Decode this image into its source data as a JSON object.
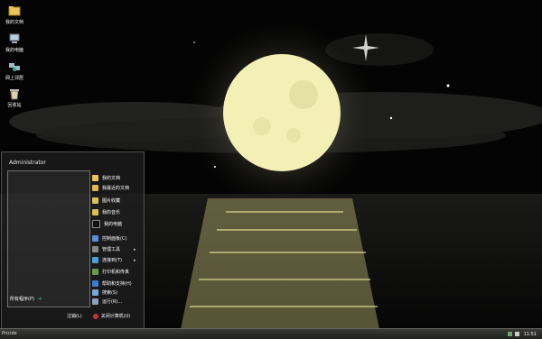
{
  "desktop": {
    "icons": [
      {
        "label": "我的文档",
        "icon": "folder-icon"
      },
      {
        "label": "我的电脑",
        "icon": "computer-icon"
      },
      {
        "label": "网上邻居",
        "icon": "network-icon"
      },
      {
        "label": "回收站",
        "icon": "recycle-bin-icon"
      }
    ]
  },
  "start_menu": {
    "user": "Administrator",
    "all_programs": "所有程序(P)",
    "right_items": [
      {
        "label": "我的文档",
        "icon": "folder-icon"
      },
      {
        "label": "我最近的文档",
        "icon": "recent-docs-icon"
      },
      {
        "label": "图片收藏",
        "icon": "pictures-icon"
      },
      {
        "label": "我的音乐",
        "icon": "music-icon"
      },
      {
        "label": "我的电脑",
        "icon": "computer-icon"
      },
      {
        "label": "控制面板(C)",
        "icon": "control-panel-icon"
      },
      {
        "label": "管理工具",
        "icon": "admin-tools-icon",
        "has_submenu": true
      },
      {
        "label": "连接到(T)",
        "icon": "connect-icon",
        "has_submenu": true
      },
      {
        "label": "打印机和传真",
        "icon": "printer-icon"
      },
      {
        "label": "帮助和支持(H)",
        "icon": "help-icon"
      },
      {
        "label": "搜索(S)",
        "icon": "search-icon"
      },
      {
        "label": "运行(R)...",
        "icon": "run-icon"
      }
    ],
    "logoff": "注销(L)",
    "shutdown": "关闭计算机(U)"
  },
  "taskbar": {
    "start_label": "Pricide",
    "clock": "11:51"
  },
  "colors": {
    "moon": "#f3f0b5",
    "sky": "#050505",
    "reflection": "#d6d28a"
  }
}
